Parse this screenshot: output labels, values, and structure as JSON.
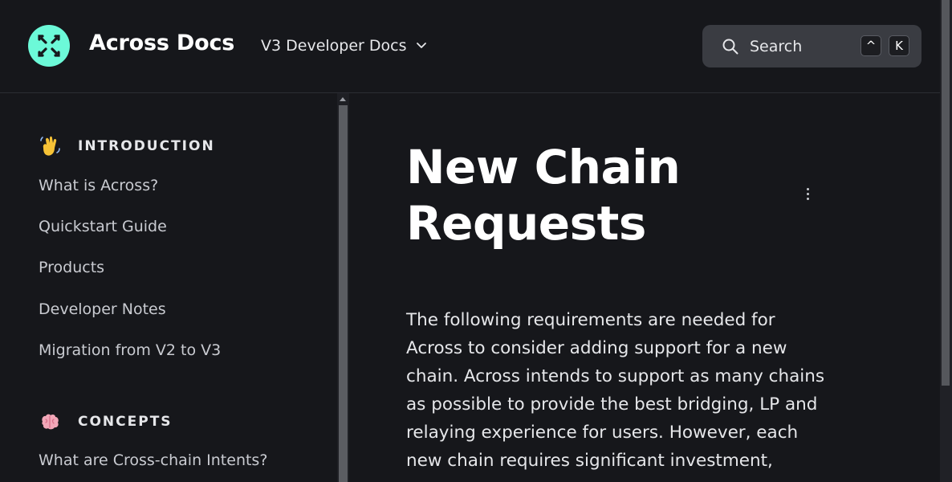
{
  "header": {
    "site_title": "Across Docs",
    "version_label": "V3 Developer Docs",
    "search_placeholder": "Search",
    "shortcut_keys": [
      "^",
      "K"
    ]
  },
  "sidebar": {
    "sections": [
      {
        "emoji": "waving-hand-icon",
        "label": "INTRODUCTION",
        "items": [
          "What is Across?",
          "Quickstart Guide",
          "Products",
          "Developer Notes",
          "Migration from V2 to V3"
        ]
      },
      {
        "emoji": "brain-icon",
        "label": "CONCEPTS",
        "items": [
          "What are Cross-chain Intents?"
        ]
      }
    ]
  },
  "main": {
    "title": "New Chain Requests",
    "body": "The following requirements are needed for Across to consider adding support for a new chain. Across intends to support as many chains as possible to provide the best bridging, LP and relaying experience for users. However, each new chain requires significant investment,"
  },
  "colors": {
    "background": "#16171b",
    "brand": "#6cf9d8",
    "search_bg": "#3a3c42"
  }
}
